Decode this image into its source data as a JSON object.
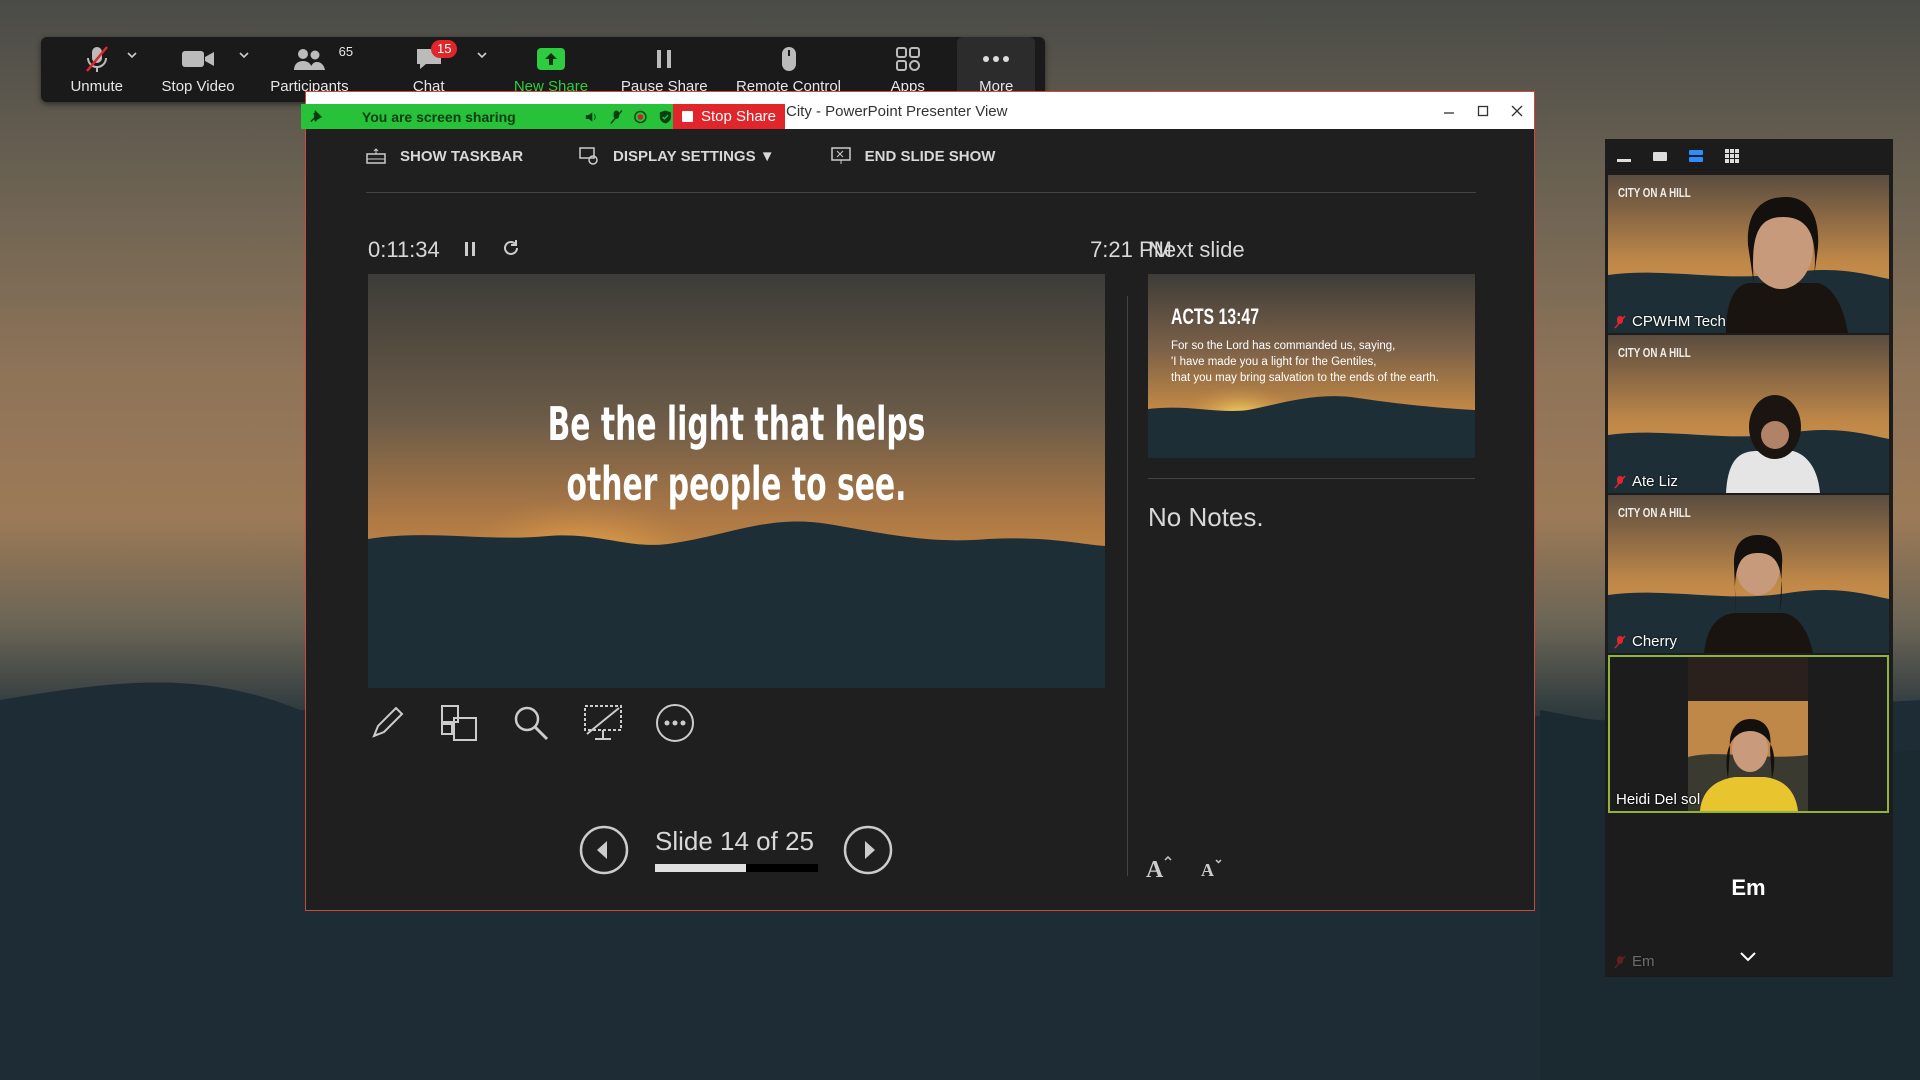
{
  "zoom_toolbar": {
    "unmute": "Unmute",
    "stop_video": "Stop Video",
    "participants": "Participants",
    "participant_count": "65",
    "chat": "Chat",
    "chat_badge": "15",
    "new_share": "New Share",
    "pause_share": "Pause Share",
    "remote_control": "Remote Control",
    "apps": "Apps",
    "more": "More"
  },
  "share_bar": {
    "status": "You are screen sharing",
    "stop_share": "Stop Share"
  },
  "presenter": {
    "window_title": "City - PowerPoint Presenter View",
    "menu": {
      "show_taskbar": "SHOW TASKBAR",
      "display_settings": "DISPLAY SETTINGS ▼",
      "end_slide_show": "END SLIDE SHOW"
    },
    "timer": "0:11:34",
    "clock": "7:21 PM",
    "current_slide": {
      "line1": "Be the light that helps",
      "line2": "other people to see."
    },
    "slide_counter": "Slide 14 of 25",
    "current_slide_number": 14,
    "total_slides": 25,
    "next_slide_label": "Next slide",
    "next_slide": {
      "title": "ACTS 13:47",
      "line1": "For so the Lord has commanded us, saying,",
      "line2": "'I have made you a light for the Gentiles,",
      "line3": "that you may bring salvation to the ends of the earth."
    },
    "notes": "No Notes."
  },
  "gallery": {
    "participants": [
      {
        "name": "CPWHM Tech",
        "muted": true
      },
      {
        "name": "Ate Liz",
        "muted": true
      },
      {
        "name": "Cherry",
        "muted": true
      },
      {
        "name": "Heidi Del sol",
        "muted": false,
        "active_speaker": true
      },
      {
        "name": "Em",
        "initials": "Em",
        "muted": true
      }
    ],
    "logo_text": "CITY ON A HILL"
  },
  "colors": {
    "share_green": "#27c13a",
    "stop_red": "#e0262b",
    "active_speaker_border": "#8fb33d"
  }
}
